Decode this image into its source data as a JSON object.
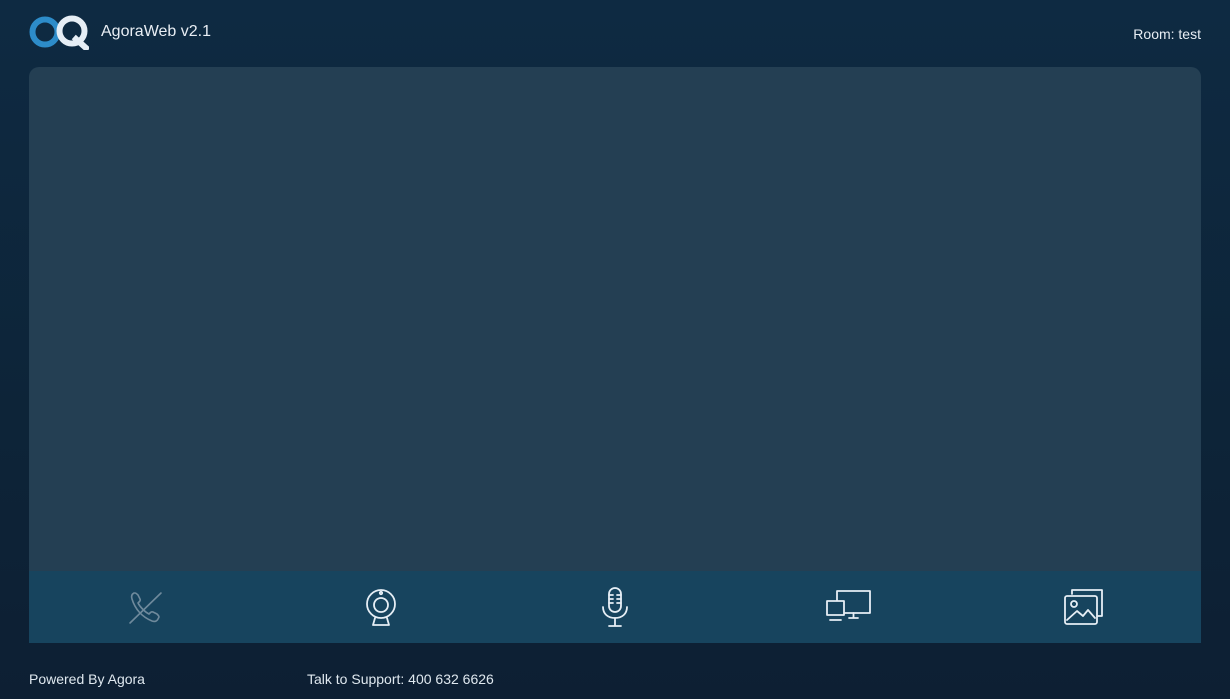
{
  "header": {
    "app_title": "AgoraWeb v2.1",
    "room_label": "Room: test",
    "logo_icon": "agora-logo-icon"
  },
  "toolbar": {
    "buttons": [
      {
        "name": "end-call-button",
        "icon": "phone-off-icon"
      },
      {
        "name": "camera-button",
        "icon": "webcam-icon"
      },
      {
        "name": "microphone-button",
        "icon": "microphone-icon"
      },
      {
        "name": "screen-share-button",
        "icon": "screen-share-icon"
      },
      {
        "name": "display-mode-button",
        "icon": "gallery-icon"
      }
    ]
  },
  "footer": {
    "powered_by": "Powered By Agora",
    "support": "Talk to Support: 400 632 6626"
  },
  "colors": {
    "background": "#0e2a42",
    "video_area": "#243f53",
    "toolbar": "#17445e",
    "logo_blue": "#2d8cc9",
    "logo_white": "#e6eef5"
  }
}
